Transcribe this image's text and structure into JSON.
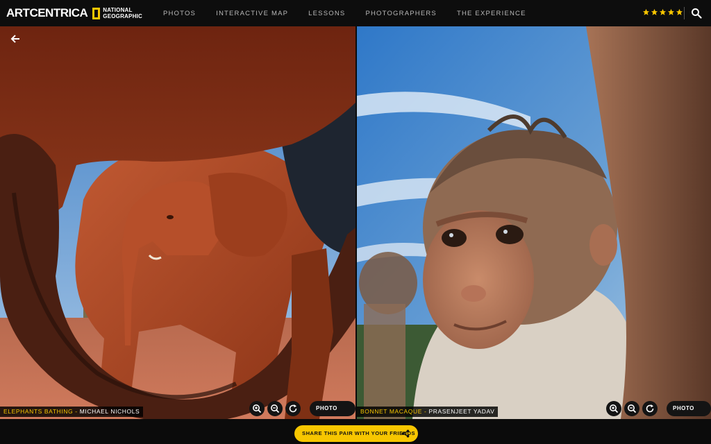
{
  "brand": {
    "name": "ARTCENTRICA",
    "partner_line1": "NATIONAL",
    "partner_line2": "GEOGRAPHIC"
  },
  "nav": {
    "items": [
      "PHOTOS",
      "INTERACTIVE MAP",
      "LESSONS",
      "PHOTOGRAPHERS",
      "THE EXPERIENCE"
    ]
  },
  "header": {
    "rating_stars": 5,
    "star_color": "#f7c600"
  },
  "left_photo": {
    "title": "ELEPHANTS BATHING",
    "separator": "-",
    "author": "MICHAEL NICHOLS",
    "info_label": "PHOTO INFO"
  },
  "right_photo": {
    "title": "BONNET MACAQUE",
    "separator": "-",
    "author": "PRASENJEET YADAV",
    "info_label": "PHOTO INFO"
  },
  "footer": {
    "share_label": "SHARE THIS PAIR WITH YOUR FRIENDS"
  },
  "colors": {
    "accent": "#f7c600",
    "background": "#0b0b0b"
  },
  "icons": {
    "back": "arrow-left-icon",
    "search": "search-icon",
    "zoom_in": "zoom-in-icon",
    "zoom_out": "zoom-out-icon",
    "reset": "refresh-icon",
    "share": "share-icon"
  }
}
